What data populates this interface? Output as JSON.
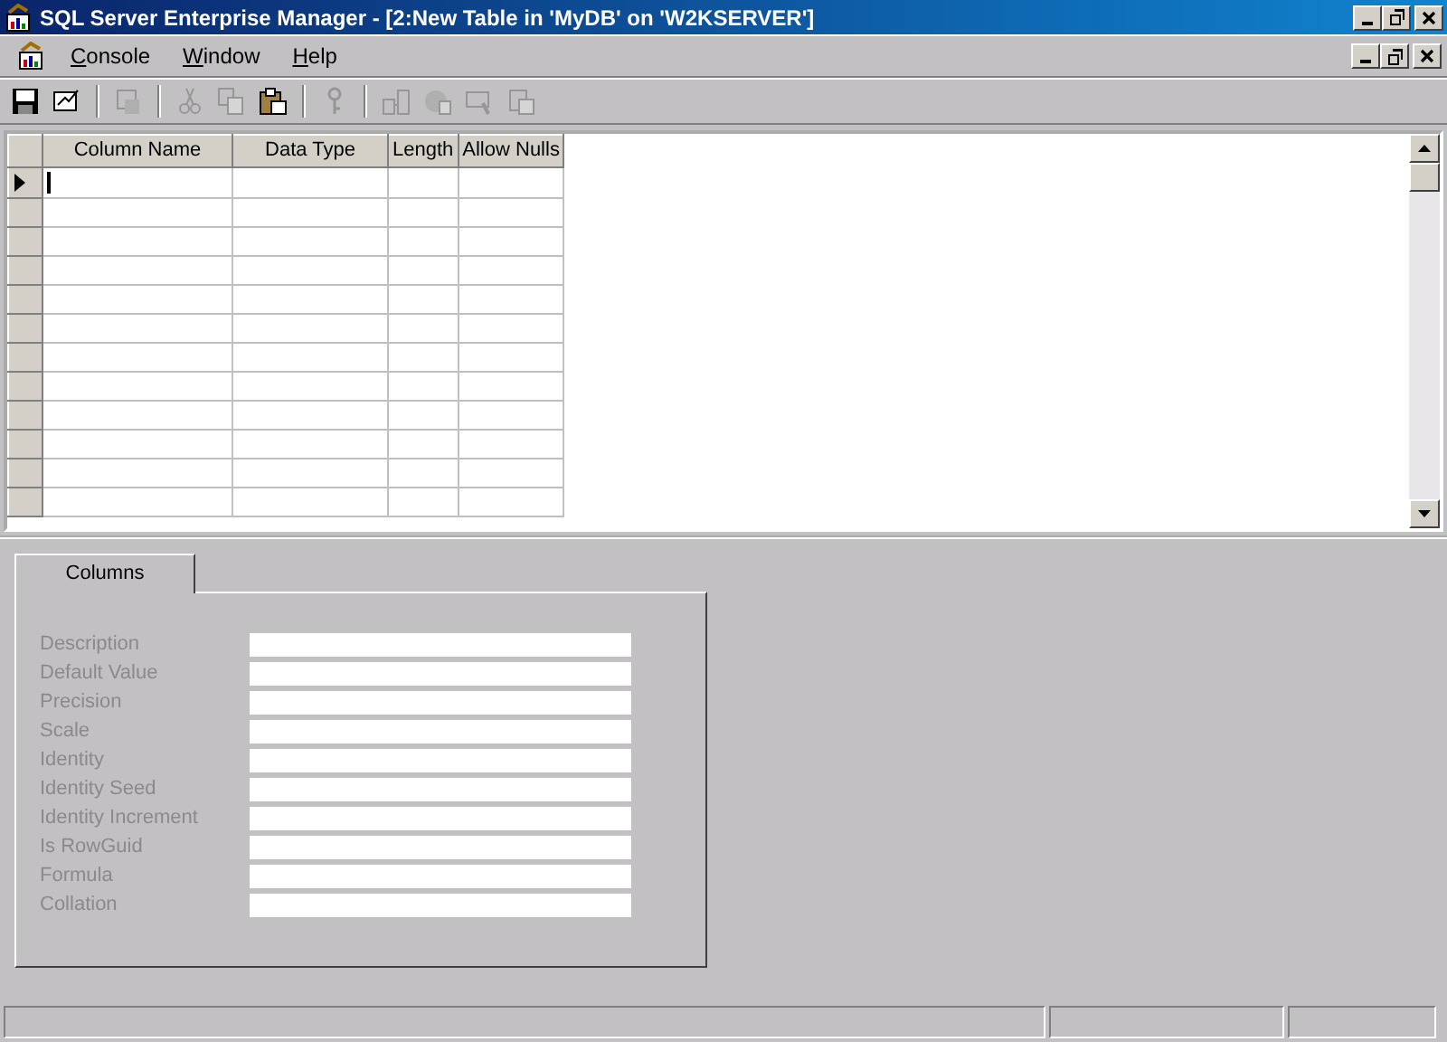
{
  "window": {
    "title": "SQL Server Enterprise Manager - [2:New Table in 'MyDB' on 'W2KSERVER']"
  },
  "menu": [
    {
      "label": "Console"
    },
    {
      "label": "Window"
    },
    {
      "label": "Help"
    }
  ],
  "toolbar": [
    {
      "kind": "save",
      "disabled": false
    },
    {
      "kind": "properties",
      "disabled": false
    },
    {
      "kind": "separator"
    },
    {
      "kind": "script",
      "disabled": true
    },
    {
      "kind": "separator"
    },
    {
      "kind": "cut",
      "disabled": true
    },
    {
      "kind": "copy",
      "disabled": true
    },
    {
      "kind": "paste",
      "disabled": false
    },
    {
      "kind": "separator"
    },
    {
      "kind": "key",
      "disabled": true
    },
    {
      "kind": "separator"
    },
    {
      "kind": "relations",
      "disabled": true
    },
    {
      "kind": "indexes",
      "disabled": true
    },
    {
      "kind": "checks",
      "disabled": true
    },
    {
      "kind": "permissions",
      "disabled": true
    }
  ],
  "grid": {
    "columns": [
      "Column Name",
      "Data Type",
      "Length",
      "Allow Nulls"
    ],
    "rows": [
      {
        "current": true
      },
      {
        "current": false
      },
      {
        "current": false
      },
      {
        "current": false
      },
      {
        "current": false
      },
      {
        "current": false
      },
      {
        "current": false
      },
      {
        "current": false
      },
      {
        "current": false
      },
      {
        "current": false
      },
      {
        "current": false
      },
      {
        "current": false
      }
    ]
  },
  "tabs": [
    {
      "label": "Columns",
      "selected": true
    }
  ],
  "properties": [
    {
      "label": "Description",
      "disabled": true
    },
    {
      "label": "Default Value",
      "disabled": true
    },
    {
      "label": "Precision",
      "disabled": true
    },
    {
      "label": "Scale",
      "disabled": true
    },
    {
      "label": "Identity",
      "disabled": true
    },
    {
      "label": "Identity Seed",
      "disabled": true
    },
    {
      "label": "Identity Increment",
      "disabled": true
    },
    {
      "label": "Is RowGuid",
      "disabled": true
    },
    {
      "label": "Formula",
      "disabled": true
    },
    {
      "label": "Collation",
      "disabled": true
    }
  ]
}
